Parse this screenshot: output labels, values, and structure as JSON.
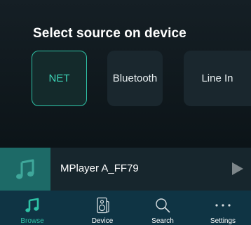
{
  "source_panel": {
    "title": "Select source on device",
    "sources": [
      {
        "label": "NET",
        "selected": true
      },
      {
        "label": "Bluetooth",
        "selected": false
      },
      {
        "label": "Line In",
        "selected": false
      }
    ]
  },
  "now_playing": {
    "title": "MPlayer A_FF79",
    "art_icon": "music-note-icon",
    "action_icon": "play-icon"
  },
  "tabbar": {
    "tabs": [
      {
        "label": "Browse",
        "icon": "music-note-icon",
        "active": true
      },
      {
        "label": "Device",
        "icon": "speaker-icon",
        "active": false
      },
      {
        "label": "Search",
        "icon": "search-icon",
        "active": false
      },
      {
        "label": "Settings",
        "icon": "more-dots-icon",
        "active": false
      }
    ]
  },
  "colors": {
    "accent": "#2ec2a6",
    "panel_bg": "#151f25",
    "tab_bg": "#0f3444",
    "now_playing_bg": "#17262d",
    "art_bg": "#1d6a67"
  }
}
